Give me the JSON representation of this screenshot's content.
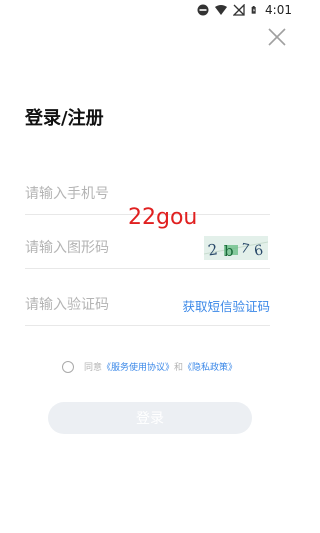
{
  "status_bar": {
    "time": "4:01",
    "icons": [
      "do-not-disturb-icon",
      "wifi-icon",
      "no-sim-icon",
      "battery-icon"
    ]
  },
  "header": {
    "title": "登录/注册"
  },
  "form": {
    "phone_placeholder": "请输入手机号",
    "captcha_placeholder": "请输入图形码",
    "captcha_image_text": "2b76",
    "sms_placeholder": "请输入验证码",
    "sms_button": "获取短信验证码"
  },
  "overlay": {
    "text": "22gou"
  },
  "agreement": {
    "prefix": "同意",
    "service_link": "《服务使用协议》",
    "connector": "和",
    "privacy_link": "《隐私政策》"
  },
  "login_button": "登录",
  "colors": {
    "accent": "#3b88e8",
    "overlay_text": "#e02020",
    "button_bg": "#eceff3",
    "placeholder": "#b4b4b4"
  }
}
